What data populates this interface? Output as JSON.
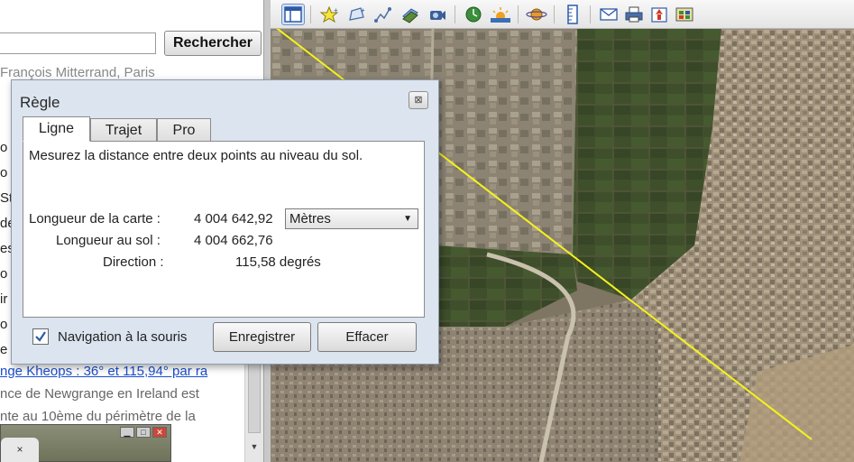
{
  "search": {
    "input_value": "",
    "button_label": "Rechercher",
    "result_text": "François Mitterrand, Paris"
  },
  "sidebar_fragments": [
    "o",
    "o",
    "St",
    "de",
    "es",
    "o",
    "ir",
    "o",
    "e"
  ],
  "document": {
    "link_text": "nge Kheops : 36° et 115,94° par ra",
    "line1": "nce de Newgrange en Ireland est",
    "line2": "nte au 10ème du périmètre de la"
  },
  "mini_window": {
    "tab_label": "×"
  },
  "toolbar": {
    "icons": [
      "sidebar-toggle-icon",
      "placemark-icon",
      "polygon-icon",
      "path-icon",
      "image-overlay-icon",
      "tour-icon",
      "historical-imagery-icon",
      "sunlight-icon",
      "planets-icon",
      "ruler-icon",
      "email-icon",
      "print-icon",
      "view-in-maps-icon",
      "layers-icon"
    ]
  },
  "ruler": {
    "title": "Règle",
    "close_glyph": "⊠",
    "tabs": [
      "Ligne",
      "Trajet",
      "Pro"
    ],
    "description": "Mesurez la distance entre deux points au niveau du sol.",
    "map_length_label": "Longueur de la carte :",
    "map_length_value": "4 004 642,92",
    "unit": "Mètres",
    "ground_length_label": "Longueur au sol :",
    "ground_length_value": "4 004 662,76",
    "direction_label": "Direction :",
    "direction_value": "115,58 degrés",
    "mouse_nav_label": "Navigation à la souris",
    "mouse_nav_checked": true,
    "save_button": "Enregistrer",
    "clear_button": "Effacer"
  },
  "colors": {
    "ruler_line": "#f5f21c",
    "dialog_bg": "#dbe4ef",
    "link": "#1a4fd0"
  }
}
